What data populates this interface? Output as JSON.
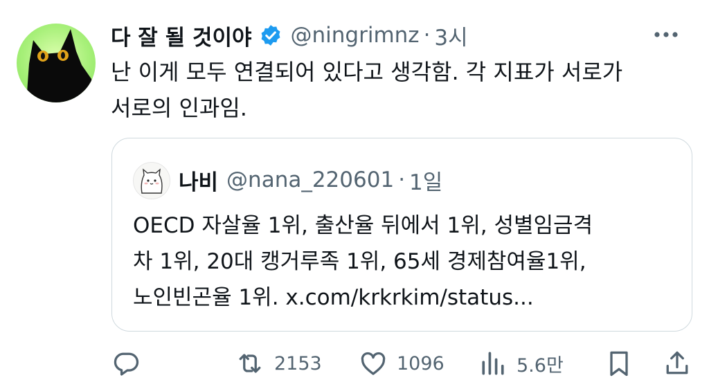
{
  "tweet": {
    "display_name": "다 잘 될 것이야",
    "handle": "@ningrimnz",
    "separator": "·",
    "time": "3시",
    "text_lines": [
      "난 이게 모두 연결되어 있다고 생각함. 각 지표가 서로가",
      "서로의 인과임."
    ],
    "icons": {
      "avatar": "black-cat-avatar",
      "verified": "verified-badge-icon",
      "more": "more-options-icon"
    },
    "colors": {
      "accent": "#1d9bf0",
      "secondary_text": "#536471",
      "border": "#cfd9de"
    }
  },
  "quote": {
    "display_name": "나비",
    "handle": "@nana_220601",
    "separator": "·",
    "time": "1일",
    "text_lines": [
      "OECD 자살율 1위, 출산율 뒤에서 1위, 성별임금격",
      "차 1위, 20대 캥거루족 1위, 65세 경제참여율1위,",
      "노인빈곤율 1위. x.com/krkrkim/status..."
    ]
  },
  "actions": {
    "reply": {
      "icon": "reply-icon",
      "count": ""
    },
    "retweet": {
      "icon": "retweet-icon",
      "count": "2153"
    },
    "like": {
      "icon": "heart-icon",
      "count": "1096"
    },
    "views": {
      "icon": "views-icon",
      "count": "5.6만"
    },
    "bookmark": {
      "icon": "bookmark-icon"
    },
    "share": {
      "icon": "share-icon"
    }
  }
}
